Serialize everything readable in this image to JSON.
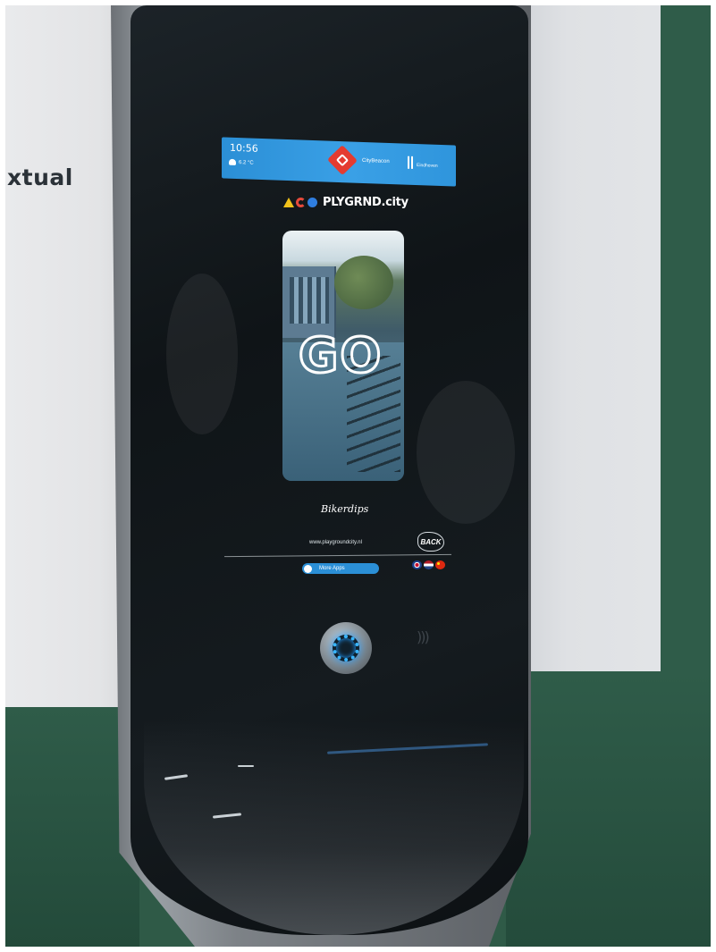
{
  "wall": {
    "sign_text": "xtual"
  },
  "kiosk": {
    "status_bar": {
      "time": "10:56",
      "temperature": "6.2 °C",
      "brand": "CityBeacon",
      "partner": "Eindhoven"
    },
    "app": {
      "title": "PLYGRND.city",
      "preview_overlay": "GO",
      "name": "Bikerdips",
      "url": "www.playgroundcity.nl",
      "back_label": "BACK",
      "more_apps_label": "More Apps",
      "languages": [
        "English",
        "Nederlands",
        "中文"
      ]
    },
    "icons": {
      "home": "home-ring-icon",
      "nfc": "nfc-icon",
      "weather": "weather-icon",
      "city_logo": "citybeacon-logo-icon"
    }
  },
  "colors": {
    "status_bar": "#2b8fd6",
    "accent_ring": "#38b5ff",
    "wall_green": "#2f5c49",
    "kiosk_glass": "#11171a"
  }
}
